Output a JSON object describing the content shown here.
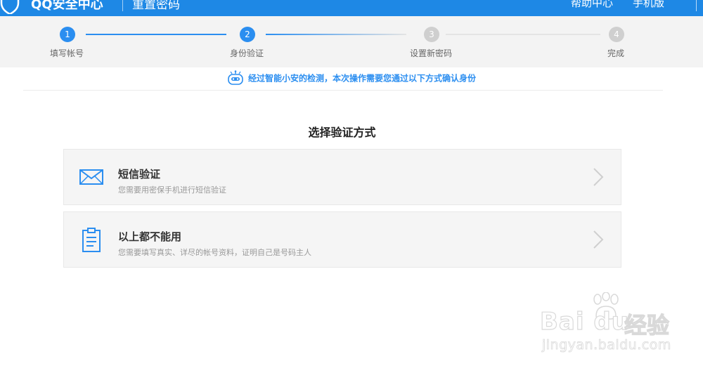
{
  "header": {
    "brand": "QQ安全中心",
    "subtitle": "重置密码",
    "links": [
      "帮助中心",
      "手机版"
    ],
    "bg_color": "#1e88e5"
  },
  "steps": [
    {
      "num": "1",
      "label": "填写帐号",
      "state": "done"
    },
    {
      "num": "2",
      "label": "身份验证",
      "state": "active"
    },
    {
      "num": "3",
      "label": "设置新密码",
      "state": "todo"
    },
    {
      "num": "4",
      "label": "完成",
      "state": "todo"
    }
  ],
  "notice": {
    "icon": "robot-icon",
    "text": "经过智能小安的检测，本次操作需要您通过以下方式确认身份"
  },
  "section_title": "选择验证方式",
  "options": [
    {
      "icon": "envelope-icon",
      "title": "短信验证",
      "desc": "您需要用密保手机进行短信验证"
    },
    {
      "icon": "clipboard-icon",
      "title": "以上都不能用",
      "desc": "您需要填写真实、详尽的帐号资料，证明自己是号码主人"
    }
  ],
  "watermark": {
    "brand": "Bai du",
    "product": "经验",
    "url": "jingyan.baidu.com"
  },
  "colors": {
    "accent": "#2b8ef0",
    "option_bg": "#f5f5f5",
    "step_bar_bg": "#f3f3f3"
  }
}
